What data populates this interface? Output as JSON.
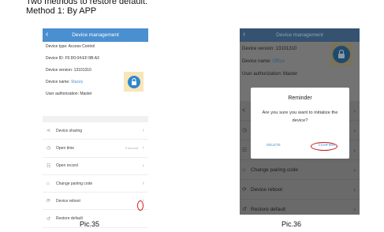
{
  "heading": {
    "line1": "Two methods to restore default:",
    "line2": "Method 1: By APP"
  },
  "phone1": {
    "back_icon": "chevron-left-icon",
    "title": "Device management",
    "info": {
      "type_label": "Device type: ",
      "type_value": "Access Control",
      "id": "Device ID: F5:D0:04:EF:9B:A3",
      "version": "Device version: 13101310",
      "name_label": "Device name: ",
      "name_value": "Stacey",
      "auth": "User authorization: Master"
    },
    "lock_icon": "lock-icon",
    "menu": [
      {
        "icon": "share-icon",
        "label": "Device sharing",
        "value": ""
      },
      {
        "icon": "clock-icon",
        "label": "Open time",
        "value": "5 second"
      },
      {
        "icon": "record-icon",
        "label": "Open record",
        "value": ""
      },
      {
        "icon": "lock-icon",
        "label": "Change pairing code",
        "value": ""
      },
      {
        "icon": "reboot-icon",
        "label": "Device reboot",
        "value": ""
      },
      {
        "icon": "restore-icon",
        "label": "Restore default",
        "value": ""
      }
    ],
    "caption": "Pic.35",
    "highlight_color": "#d11a1a"
  },
  "phone2": {
    "back_icon": "chevron-left-icon",
    "title": "Device management",
    "info": {
      "version": "Device version: 13101310",
      "name_label": "Device name: ",
      "name_value": "Office",
      "auth": "User authorization: Master"
    },
    "menu": [
      {
        "icon": "share-icon",
        "label": ""
      },
      {
        "icon": "clock-icon",
        "label": ""
      },
      {
        "icon": "record-icon",
        "label": ""
      },
      {
        "icon": "lock-icon",
        "label": "Change pairing code"
      },
      {
        "icon": "reboot-icon",
        "label": "Device reboot"
      },
      {
        "icon": "restore-icon",
        "label": "Restore default"
      }
    ],
    "dialog": {
      "title": "Reminder",
      "message": "Are you sure you want to initialize the device?",
      "delete_label": "DELETE",
      "confirm_label": "CONFIRM"
    },
    "caption": "Pic.36",
    "highlight_color": "#c31c1c"
  }
}
